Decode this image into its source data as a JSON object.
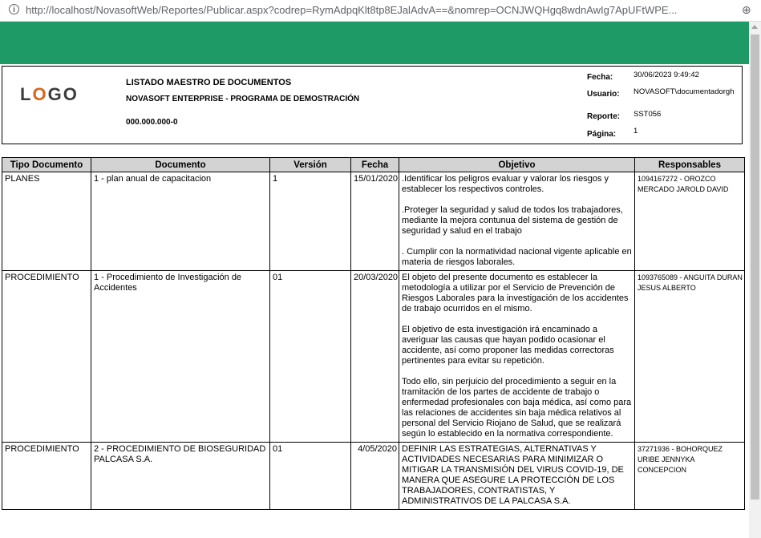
{
  "browser": {
    "url": "http://localhost/NovasoftWeb/Reportes/Publicar.aspx?codrep=RymAdpqKlt8tp8EJalAdvA==&nomrep=OCNJWQHgq8wdnAwIg7ApUFtWPE..."
  },
  "report": {
    "logo": "LOGO",
    "title": "LISTADO MAESTRO DE DOCUMENTOS",
    "company": "NOVASOFT ENTERPRISE  -  PROGRAMA DE DEMOSTRACIÓN",
    "nit": "000.000.000-0",
    "labels": {
      "fecha": "Fecha:",
      "usuario": "Usuario:",
      "reporte": "Reporte:",
      "pagina": "Página:"
    },
    "values": {
      "fecha": "30/06/2023 9:49:42",
      "usuario": "NOVASOFT\\documentadorgh",
      "reporte": "SST056",
      "pagina": "1"
    }
  },
  "table": {
    "headers": [
      "Tipo Documento",
      "Documento",
      "Versión",
      "Fecha",
      "Objetivo",
      "Responsables"
    ],
    "rows": [
      {
        "tipo": "PLANES",
        "documento": "1 - plan anual de capacitacion",
        "version": "1",
        "fecha": "15/01/2020",
        "objetivo": [
          ".Identificar los peligros evaluar y valorar los riesgos y establecer los respectivos controles.",
          ".Proteger la seguridad y salud de todos los trabajadores, mediante la mejora contunua del sistema de gestión de seguridad y salud en el trabajo",
          ". Cumplir con la normatividad nacional vigente aplicable en materia de riesgos laborales."
        ],
        "responsables": "1094167272 - OROZCO MERCADO  JAROLD DAVID"
      },
      {
        "tipo": "PROCEDIMIENTO",
        "documento": "1 - Procedimiento de Investigación de Accidentes",
        "version": "01",
        "fecha": "20/03/2020",
        "objetivo": [
          "El objeto del presente documento es establecer la metodología a utilizar por el Servicio de Prevención de Riesgos Laborales para la investigación de los accidentes de trabajo ocurridos en el mismo.",
          "El objetivo de esta investigación irá encaminado a averiguar las causas que hayan podido ocasionar el accidente, así como proponer las medidas correctoras pertinentes para evitar su repetición.",
          "Todo ello, sin perjuicio del procedimiento a seguir en la tramitación de los partes de accidente de trabajo o enfermedad profesionales con baja médica, así como para las relaciones de accidentes sin baja médica relativos al personal del Servicio Riojano de Salud, que se realizará según lo establecido en la normativa correspondiente."
        ],
        "responsables": "1093765089 - ANGUITA DURAN JESUS  ALBERTO"
      },
      {
        "tipo": "PROCEDIMIENTO",
        "documento": "2 - PROCEDIMIENTO DE BIOSEGURIDAD PALCASA S.A.",
        "version": "01",
        "fecha": "4/05/2020",
        "objetivo": [
          "DEFINIR LAS ESTRATEGIAS, ALTERNATIVAS Y ACTIVIDADES NECESARIAS PARA MINIMIZAR O MITIGAR LA TRANSMISIÓN DEL VIRUS COVID-19, DE MANERA QUE ASEGURE LA PROTECCIÓN DE LOS TRABAJADORES, CONTRATISTAS,  Y ADMINISTRATIVOS DE LA PALCASA S.A."
        ],
        "responsables": "37271936 - BOHORQUEZ URIBE JENNYKA CONCEPCION"
      }
    ]
  },
  "colors": {
    "band": "#1e9a67",
    "header_bg": "#d3d3d3",
    "logo_o": "#d4661f"
  },
  "icons": {
    "info": "info-icon",
    "zoom": "zoom-icon"
  }
}
